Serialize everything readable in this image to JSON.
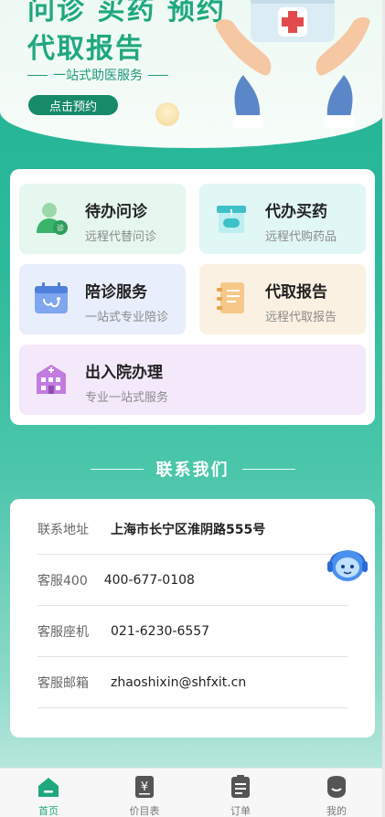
{
  "banner": {
    "title_line1": "问诊 买药 预约",
    "title_line2": "代取报告",
    "subtitle": "一站式助医服务",
    "button_label": "点击预约"
  },
  "services": [
    {
      "title": "待办问诊",
      "desc": "远程代替问诊",
      "icon": "doctor-consult-icon"
    },
    {
      "title": "代办买药",
      "desc": "远程代购药品",
      "icon": "pharmacy-icon"
    },
    {
      "title": "陪诊服务",
      "desc": "一站式专业陪诊",
      "icon": "calendar-stethoscope-icon"
    },
    {
      "title": "代取报告",
      "desc": "远程代取报告",
      "icon": "report-icon"
    },
    {
      "title": "出入院办理",
      "desc": "专业一站式服务",
      "icon": "hospital-icon"
    }
  ],
  "contact": {
    "header": "联系我们",
    "rows": [
      {
        "label": "联系地址",
        "value": "上海市长宁区淮阴路555号"
      },
      {
        "label": "客服400",
        "value": "400-677-0108"
      },
      {
        "label": "客服座机",
        "value": "021-6230-6557"
      },
      {
        "label": "客服邮箱",
        "value": "zhaoshixin@shfxit.cn"
      }
    ]
  },
  "tabbar": [
    {
      "label": "首页",
      "icon": "home-icon",
      "active": true
    },
    {
      "label": "价目表",
      "icon": "price-list-icon",
      "active": false
    },
    {
      "label": "订单",
      "icon": "order-icon",
      "active": false
    },
    {
      "label": "我的",
      "icon": "profile-icon",
      "active": false
    }
  ],
  "colors": {
    "primary": "#1fa87f",
    "background_gradient_top": "#21b394",
    "tab_active": "#1fa87f"
  }
}
